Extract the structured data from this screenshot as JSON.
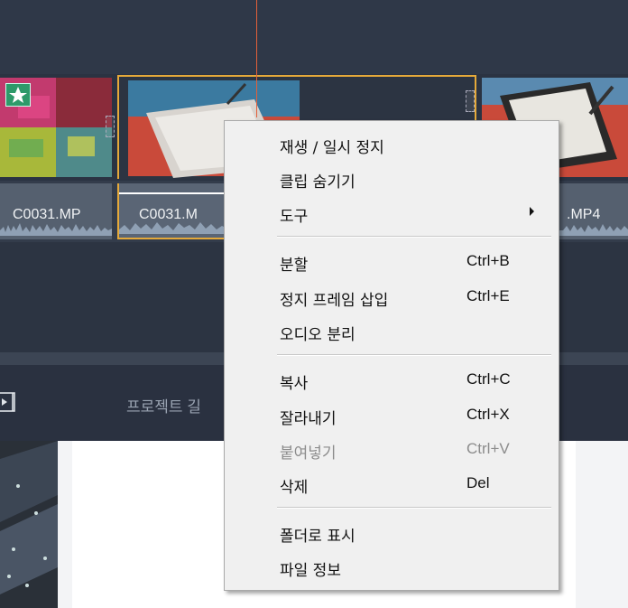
{
  "timeline": {
    "clips": [
      {
        "name": "C0031.MP",
        "has_star": true
      },
      {
        "name": "C0031.M",
        "selected": true
      },
      {
        "name": ".MP4"
      }
    ],
    "bottom_bar": {
      "project_label": "프로젝트 길"
    }
  },
  "context_menu": {
    "items": [
      {
        "label": "재생 / 일시 정지",
        "shortcut": ""
      },
      {
        "label": "클립 숨기기",
        "shortcut": ""
      },
      {
        "label": "도구",
        "shortcut": "",
        "submenu": true
      },
      {
        "label": "분할",
        "shortcut": "Ctrl+B"
      },
      {
        "label": "정지 프레임 삽입",
        "shortcut": "Ctrl+E"
      },
      {
        "label": "오디오 분리",
        "shortcut": ""
      },
      {
        "label": "복사",
        "shortcut": "Ctrl+C"
      },
      {
        "label": "잘라내기",
        "shortcut": "Ctrl+X"
      },
      {
        "label": "붙여넣기",
        "shortcut": "Ctrl+V",
        "disabled": true
      },
      {
        "label": "삭제",
        "shortcut": "Del"
      },
      {
        "label": "폴더로 표시",
        "shortcut": ""
      },
      {
        "label": "파일 정보",
        "shortcut": ""
      }
    ]
  },
  "colors": {
    "selection_border": "#e5a93a",
    "playhead": "#e2603a",
    "timeline_bg": "#2c3442"
  }
}
